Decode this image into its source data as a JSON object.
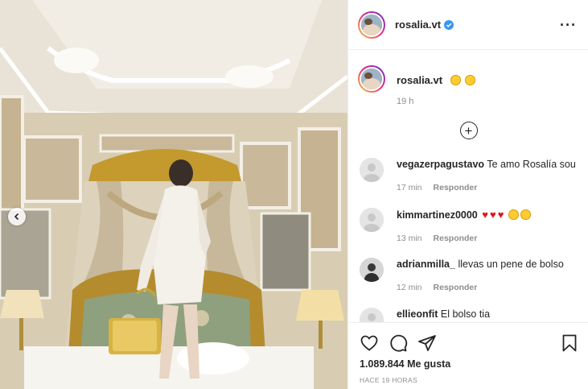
{
  "post": {
    "username": "rosalia.vt"
  },
  "caption": {
    "username": "rosalia.vt",
    "time": "19 h",
    "emojis": [
      "worried-face",
      "zany-face"
    ]
  },
  "comments": [
    {
      "username": "vegazerpagustavo",
      "text": "Te amo Rosalía sou",
      "time": "17 min",
      "reply": "Responder"
    },
    {
      "username": "kimmartinez0000",
      "text": "",
      "time": "13 min",
      "reply": "Responder",
      "emojis": [
        "red-heart",
        "red-heart",
        "red-heart",
        "heart-eyes",
        "heart-eyes"
      ]
    },
    {
      "username": "adrianmilla_",
      "text": "llevas un pene de bolso",
      "time": "12 min",
      "reply": "Responder"
    },
    {
      "username": "ellieonfit",
      "text": "El bolso tia"
    }
  ],
  "actions": {
    "likes": "1.089.844 Me gusta",
    "posted": "HACE 19 HORAS"
  },
  "icons": [
    "verified-icon",
    "more-icon",
    "add-circle-icon",
    "heart-icon",
    "comment-icon",
    "share-icon",
    "bookmark-icon",
    "chevron-left-icon"
  ],
  "colors": {
    "verified": "#3897f0",
    "heart": "#e0161e",
    "muted": "#8e8e8e"
  }
}
